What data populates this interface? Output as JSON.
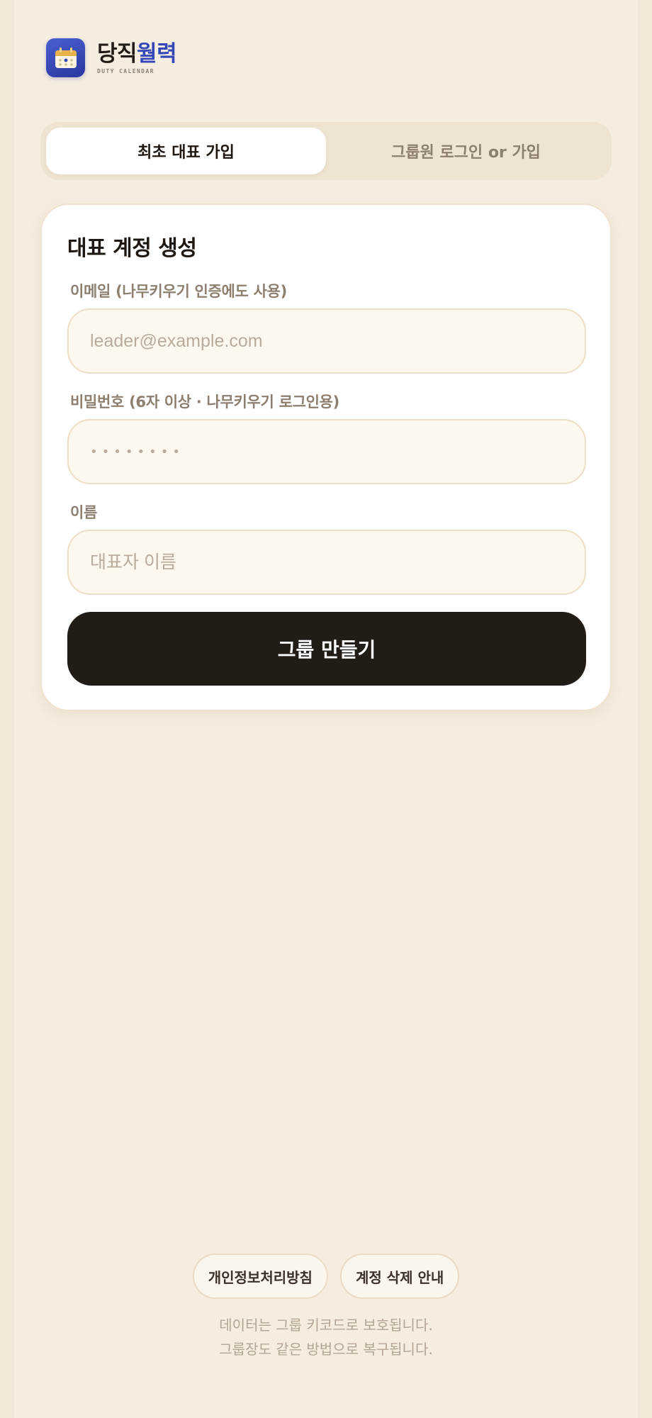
{
  "brand": {
    "title_main": "당직",
    "title_accent": "월력",
    "subtitle": "DUTY CALENDAR",
    "logo_icon": "calendar-icon"
  },
  "tabs": [
    {
      "label": "최초 대표 가입",
      "active": true
    },
    {
      "label": "그룹원 로그인 or 가입",
      "active": false
    }
  ],
  "card": {
    "title": "대표 계정 생성",
    "email": {
      "label": "이메일 (나무키우기 인증에도 사용)",
      "placeholder": "leader@example.com",
      "value": ""
    },
    "password": {
      "label": "비밀번호 (6자 이상 · 나무키우기 로그인용)",
      "masked_value": "••••••••"
    },
    "name": {
      "label": "이름",
      "placeholder": "대표자 이름",
      "value": ""
    },
    "submit_label": "그룹 만들기"
  },
  "footer": {
    "privacy_label": "개인정보처리방침",
    "delete_account_label": "계정 삭제 안내",
    "note_line1": "데이터는 그룹 키코드로 보호됩니다.",
    "note_line2": "그룹장도 같은 방법으로 복구됩니다."
  },
  "colors": {
    "background": "#f5ede0",
    "accent": "#3347b8",
    "primary_button": "#221c17"
  }
}
